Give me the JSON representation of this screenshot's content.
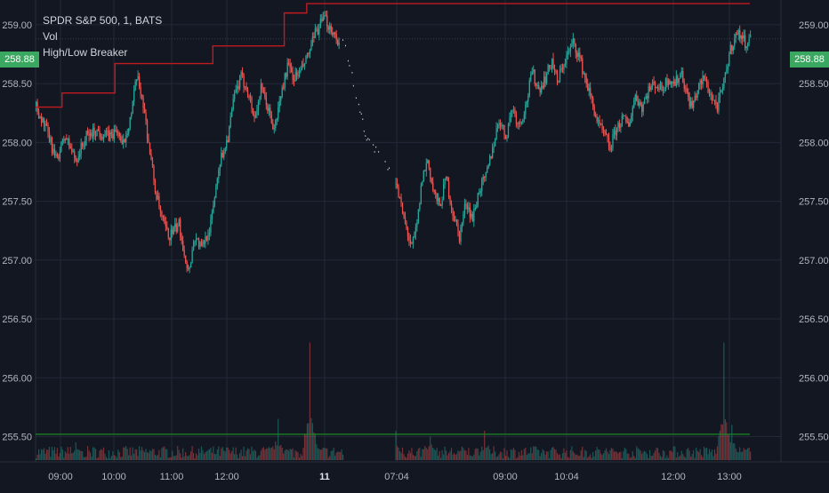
{
  "legend": {
    "symbol": "SPDR S&P 500, 1, BATS",
    "indicator_vol": "Vol",
    "indicator_hlb": "High/Low Breaker"
  },
  "last_price": "258.88",
  "colors": {
    "background": "#131722",
    "grid": "#232838",
    "up": "#26a69a",
    "down": "#ef5350",
    "breaker": "#c21a1f",
    "volume_ma": "#1b8a22",
    "price_tag": "#3aa860",
    "text": "#b2b5be"
  },
  "chart_data": {
    "type": "candlestick",
    "title": "SPDR S&P 500, 1, BATS",
    "y_axis": {
      "ticks": [
        "259.00",
        "258.50",
        "258.00",
        "257.50",
        "257.00",
        "256.50",
        "256.00",
        "255.50"
      ],
      "range": [
        255.3,
        259.15
      ]
    },
    "x_axis": {
      "ticks": [
        "09:00",
        "10:00",
        "11:00",
        "12:00",
        "11",
        "07:04",
        "09:00",
        "10:04",
        "12:00",
        "13:00"
      ],
      "bold_ticks": [
        "11"
      ]
    },
    "price_path": [
      [
        0,
        258.3
      ],
      [
        8,
        258.1
      ],
      [
        15,
        257.85
      ],
      [
        22,
        258.05
      ],
      [
        30,
        257.85
      ],
      [
        38,
        258.05
      ],
      [
        45,
        258.1
      ],
      [
        55,
        258.05
      ],
      [
        62,
        258.1
      ],
      [
        65,
        257.95
      ],
      [
        72,
        258.25
      ],
      [
        76,
        258.55
      ],
      [
        80,
        258.4
      ],
      [
        85,
        258.0
      ],
      [
        90,
        257.6
      ],
      [
        95,
        257.35
      ],
      [
        100,
        257.2
      ],
      [
        108,
        257.3
      ],
      [
        115,
        256.9
      ],
      [
        120,
        257.2
      ],
      [
        125,
        257.1
      ],
      [
        132,
        257.3
      ],
      [
        138,
        257.8
      ],
      [
        145,
        258.05
      ],
      [
        150,
        258.4
      ],
      [
        155,
        258.55
      ],
      [
        160,
        258.45
      ],
      [
        165,
        258.2
      ],
      [
        170,
        258.45
      ],
      [
        175,
        258.3
      ],
      [
        180,
        258.1
      ],
      [
        185,
        258.4
      ],
      [
        190,
        258.65
      ],
      [
        195,
        258.55
      ],
      [
        200,
        258.6
      ],
      [
        206,
        258.75
      ],
      [
        212,
        258.95
      ],
      [
        218,
        259.05
      ],
      [
        224,
        258.95
      ],
      [
        229,
        258.85
      ]
    ],
    "gap_path": [
      [
        232,
        258.85
      ],
      [
        238,
        258.65
      ],
      [
        244,
        258.3
      ],
      [
        250,
        258.05
      ],
      [
        256,
        257.95
      ],
      [
        262,
        257.85
      ],
      [
        268,
        257.75
      ]
    ],
    "session2_path": [
      [
        272,
        257.65
      ],
      [
        278,
        257.35
      ],
      [
        284,
        257.1
      ],
      [
        288,
        257.3
      ],
      [
        292,
        257.7
      ],
      [
        296,
        257.85
      ],
      [
        300,
        257.6
      ],
      [
        305,
        257.45
      ],
      [
        310,
        257.7
      ],
      [
        315,
        257.4
      ],
      [
        320,
        257.2
      ],
      [
        325,
        257.5
      ],
      [
        330,
        257.35
      ],
      [
        335,
        257.6
      ],
      [
        340,
        257.7
      ],
      [
        345,
        257.95
      ],
      [
        350,
        258.2
      ],
      [
        355,
        258.05
      ],
      [
        360,
        258.3
      ],
      [
        365,
        258.15
      ],
      [
        370,
        258.3
      ],
      [
        375,
        258.6
      ],
      [
        380,
        258.45
      ],
      [
        385,
        258.55
      ],
      [
        390,
        258.7
      ],
      [
        394,
        258.5
      ],
      [
        398,
        258.65
      ],
      [
        402,
        258.75
      ],
      [
        406,
        258.85
      ],
      [
        410,
        258.75
      ],
      [
        415,
        258.55
      ],
      [
        420,
        258.35
      ],
      [
        425,
        258.15
      ],
      [
        430,
        258.05
      ],
      [
        434,
        257.95
      ],
      [
        438,
        258.1
      ],
      [
        443,
        258.2
      ],
      [
        448,
        258.15
      ],
      [
        453,
        258.4
      ],
      [
        458,
        258.3
      ],
      [
        463,
        258.45
      ],
      [
        468,
        258.5
      ],
      [
        473,
        258.45
      ],
      [
        478,
        258.55
      ],
      [
        483,
        258.5
      ],
      [
        488,
        258.6
      ],
      [
        492,
        258.4
      ],
      [
        496,
        258.3
      ],
      [
        500,
        258.45
      ],
      [
        505,
        258.55
      ],
      [
        510,
        258.4
      ],
      [
        515,
        258.3
      ],
      [
        520,
        258.5
      ],
      [
        524,
        258.75
      ],
      [
        528,
        258.9
      ],
      [
        532,
        258.92
      ],
      [
        536,
        258.85
      ],
      [
        540,
        258.88
      ]
    ],
    "breaker_steps": [
      [
        0,
        258.3
      ],
      [
        20,
        258.42
      ],
      [
        60,
        258.67
      ],
      [
        134,
        258.82
      ],
      [
        188,
        259.1
      ],
      [
        205,
        259.18
      ],
      [
        540,
        259.18
      ]
    ],
    "volume": {
      "ma_level": 255.52,
      "spikes": [
        [
          30,
          255.45
        ],
        [
          183,
          255.65
        ],
        [
          207,
          256.3
        ],
        [
          272,
          255.55
        ],
        [
          298,
          255.5
        ],
        [
          339,
          255.55
        ],
        [
          520,
          256.3
        ],
        [
          526,
          255.6
        ]
      ]
    }
  }
}
